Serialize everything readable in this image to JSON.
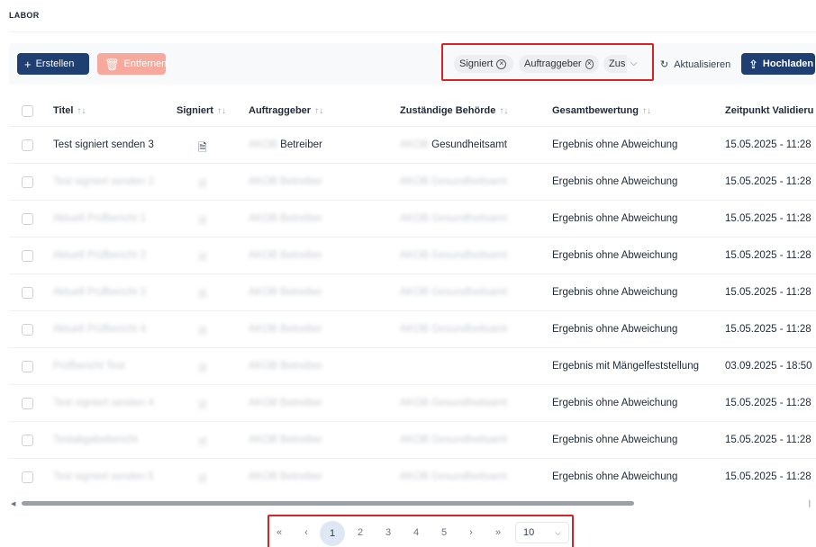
{
  "section": {
    "title": "LABOR"
  },
  "toolbar": {
    "create_label": "Erstellen",
    "remove_label": "Entfernen",
    "filter_chips": [
      "Signiert",
      "Auftraggeber",
      "Zus"
    ],
    "refresh_label": "Aktualisieren",
    "upload_label": "Hochladen"
  },
  "table": {
    "headers": {
      "titel": "Titel",
      "signiert": "Signiert",
      "auftraggeber": "Auftraggeber",
      "behoerde": "Zuständige Behörde",
      "gesamt": "Gesamtbewertung",
      "zeit": "Zeitpunkt Validieru"
    },
    "rows": [
      {
        "titel": "Test signiert senden 3",
        "auftraggeber": "Betreiber",
        "behoerde": "Gesundheitsamt",
        "gesamt": "Ergebnis ohne Abweichung",
        "zeit": "15.05.2025  -  11:28"
      },
      {
        "titel": "Test signiert senden 2",
        "auftraggeber": "AKOB Betreiber",
        "behoerde": "AKOB Gesundheitsamt",
        "gesamt": "Ergebnis ohne Abweichung",
        "zeit": "15.05.2025  -  11:28"
      },
      {
        "titel": "Aktuell Prüfbericht 1",
        "auftraggeber": "AKOB Betreiber",
        "behoerde": "AKOB Gesundheitsamt",
        "gesamt": "Ergebnis ohne Abweichung",
        "zeit": "15.05.2025  -  11:28"
      },
      {
        "titel": "Aktuell Prüfbericht 2",
        "auftraggeber": "AKOB Betreiber",
        "behoerde": "AKOB Gesundheitsamt",
        "gesamt": "Ergebnis ohne Abweichung",
        "zeit": "15.05.2025  -  11:28"
      },
      {
        "titel": "Aktuell Prüfbericht 3",
        "auftraggeber": "AKOB Betreiber",
        "behoerde": "AKOB Gesundheitsamt",
        "gesamt": "Ergebnis ohne Abweichung",
        "zeit": "15.05.2025  -  11:28"
      },
      {
        "titel": "Aktuell Prüfbericht 4",
        "auftraggeber": "AKOB Betreiber",
        "behoerde": "AKOB Gesundheitsamt",
        "gesamt": "Ergebnis ohne Abweichung",
        "zeit": "15.05.2025  -  11:28"
      },
      {
        "titel": "Prüfbericht Test",
        "auftraggeber": "AKOB Betreiber",
        "behoerde": "",
        "gesamt": "Ergebnis mit Mängelfeststellung",
        "zeit": "03.09.2025  -  18:50"
      },
      {
        "titel": "Test signiert senden 4",
        "auftraggeber": "AKOB Betreiber",
        "behoerde": "AKOB Gesundheitsamt",
        "gesamt": "Ergebnis ohne Abweichung",
        "zeit": "15.05.2025  -  11:28"
      },
      {
        "titel": "Testabgabebericht",
        "auftraggeber": "AKOB Betreiber",
        "behoerde": "AKOB Gesundheitsamt",
        "gesamt": "Ergebnis ohne Abweichung",
        "zeit": "15.05.2025  -  11:28"
      },
      {
        "titel": "Test signiert senden 5",
        "auftraggeber": "AKOB Betreiber",
        "behoerde": "AKOB Gesundheitsamt",
        "gesamt": "Ergebnis ohne Abweichung",
        "zeit": "15.05.2025  -  11:28"
      }
    ]
  },
  "pagination": {
    "first": "«",
    "prev": "‹",
    "pages": [
      "1",
      "2",
      "3",
      "4",
      "5"
    ],
    "active_page": "1",
    "next": "›",
    "last": "»",
    "page_size": "10"
  },
  "colors": {
    "primary": "#1f3f73",
    "danger_soft": "#f6a99c",
    "highlight": "#d62424"
  },
  "icons": [
    "plus-icon",
    "trash-icon",
    "close-circle-icon",
    "chevron-down-icon",
    "refresh-icon",
    "upload-icon",
    "sort-icon",
    "excel-file-icon"
  ]
}
